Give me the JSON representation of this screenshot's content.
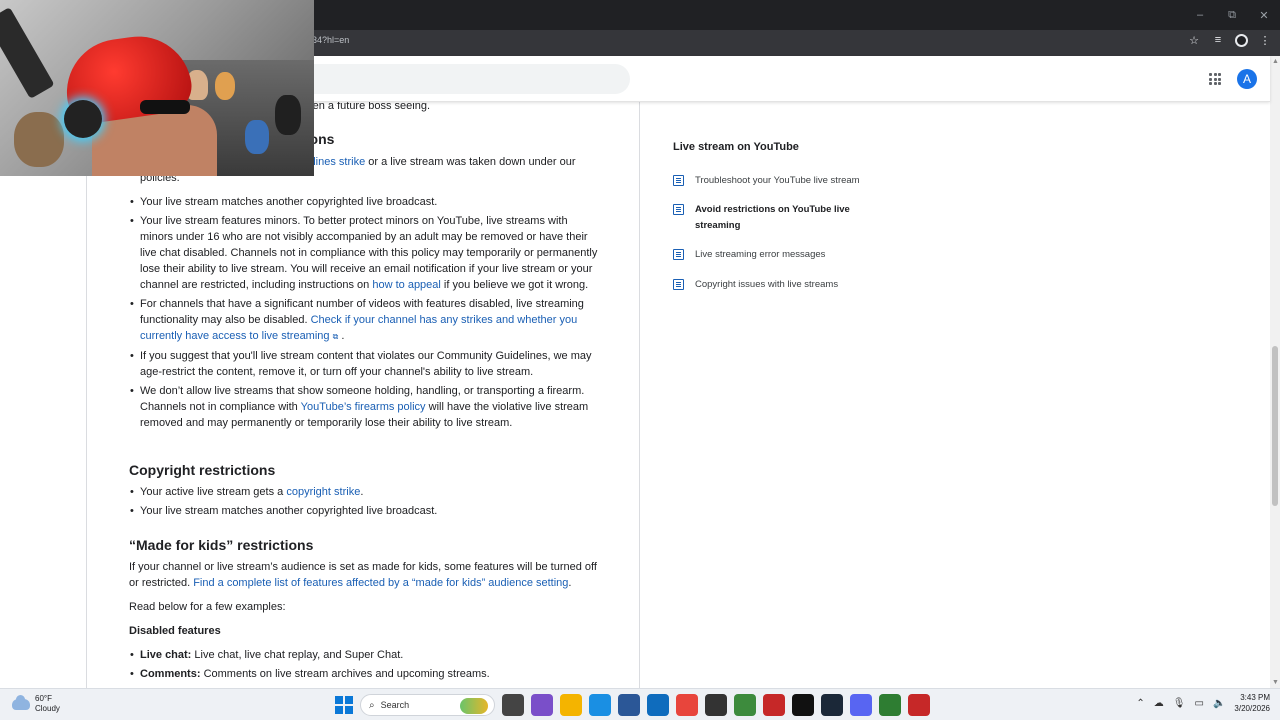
{
  "browser": {
    "url_visible": "34?hl=en",
    "window_controls": {
      "minimize": "–",
      "restore": "⧉",
      "close": "✕"
    },
    "avatar_letter": "A"
  },
  "article": {
    "partial_top": "even a future boss seeing.",
    "partial_heading": "tions",
    "partial_line_link": "delines strike",
    "partial_line_rest": " or a live stream was taken down under our",
    "partial_line2": "policies.",
    "bullets_a": [
      {
        "text": "Your live stream matches another copyrighted live broadcast."
      },
      {
        "pre": "Your live stream features minors. To better protect minors on YouTube, live streams with minors under 16 who are not visibly accompanied by an adult may be removed or have their live chat disabled. Channels not in compliance with this policy may temporarily or permanently lose their ability to live stream. You will receive an email notification if your live stream or your channel are restricted, including instructions on ",
        "link": "how to appeal",
        "post": " if you believe we got it wrong."
      },
      {
        "pre": "For channels that have a significant number of videos with features disabled, live streaming functionality may also be disabled. ",
        "link": "Check if your channel has any strikes and whether you currently have access to live streaming",
        "post": " ."
      },
      {
        "text": "If you suggest that you'll live stream content that violates our Community Guidelines, we may age-restrict the content, remove it, or turn off your channel's ability to live stream."
      },
      {
        "pre": "We don’t allow live streams that show someone holding, handling, or transporting a firearm. Channels not in compliance with ",
        "link": "YouTube’s firearms policy",
        "post": " will have the violative live stream removed and may permanently or temporarily lose their ability to live stream."
      }
    ],
    "copyright_heading": "Copyright restrictions",
    "copyright_bullet1_pre": "Your active live stream gets a ",
    "copyright_bullet1_link": "copyright strike",
    "copyright_bullet1_post": ".",
    "copyright_bullet2": "Your live stream matches another copyrighted live broadcast.",
    "mfk_heading": "“Made for kids” restrictions",
    "mfk_para_pre": "If your channel or live stream’s audience is set as made for kids, some features will be turned off or restricted. ",
    "mfk_para_link": "Find a complete list of features affected by a “made for kids” audience setting",
    "mfk_para_post": ".",
    "read_below": "Read below for a few examples:",
    "disabled_heading": "Disabled features",
    "disabled_items": [
      {
        "label": "Live chat:",
        "text": " Live chat, live chat replay, and Super Chat."
      },
      {
        "label": "Comments:",
        "text": " Comments on live stream archives and upcoming streams."
      }
    ]
  },
  "sidebar": {
    "title": "Live stream on YouTube",
    "items": [
      {
        "label": "Troubleshoot your YouTube live stream",
        "active": false
      },
      {
        "label": "Avoid restrictions on YouTube live streaming",
        "active": true
      },
      {
        "label": "Live streaming error messages",
        "active": false
      },
      {
        "label": "Copyright issues with live streams",
        "active": false
      }
    ]
  },
  "taskbar": {
    "weather_temp": "60°F",
    "weather_desc": "Cloudy",
    "search_label": "Search",
    "time": "3:43 PM",
    "date": "3/20/2026"
  }
}
